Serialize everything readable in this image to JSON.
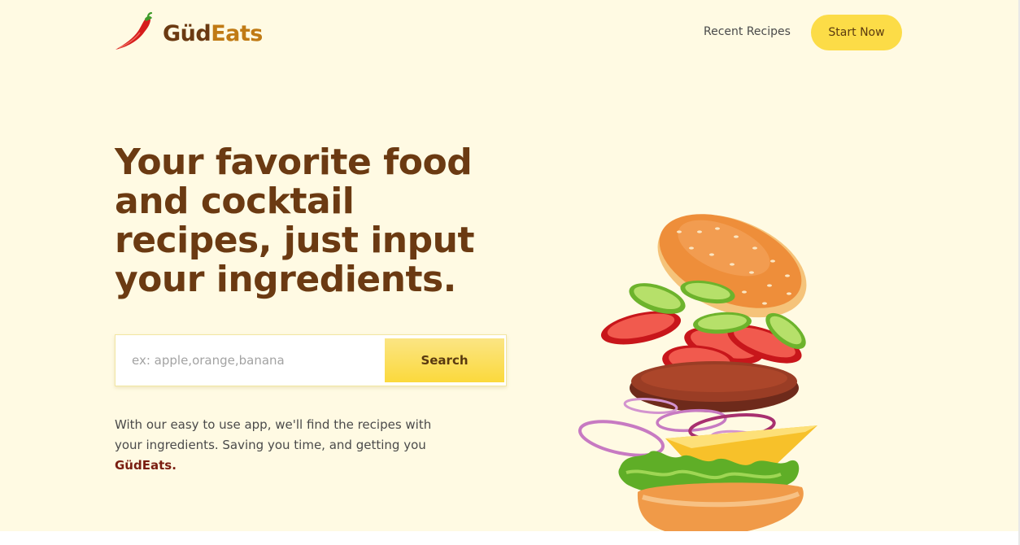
{
  "brand": {
    "name_part1": "Güd",
    "name_part2": "Eats",
    "logo_icon": "chili-pepper-icon"
  },
  "nav": {
    "recent_recipes": "Recent Recipes",
    "start_now": "Start Now"
  },
  "hero": {
    "title": "Your favorite food and cocktail recipes, just input your ingredients.",
    "search": {
      "placeholder": "ex: apple,orange,banana",
      "value": "",
      "button_label": "Search"
    },
    "description": "With our easy to use app, we'll find the recipes with your ingredients. Saving you time, and getting you",
    "description_brand": "GüdEats."
  },
  "illustration": {
    "name": "flying-burger-illustration"
  },
  "colors": {
    "background": "#fffae3",
    "accent_yellow": "#fcdc47",
    "brand_brown": "#6b3a12",
    "brand_orange": "#c07a14",
    "brand_red": "#7a1d10"
  }
}
